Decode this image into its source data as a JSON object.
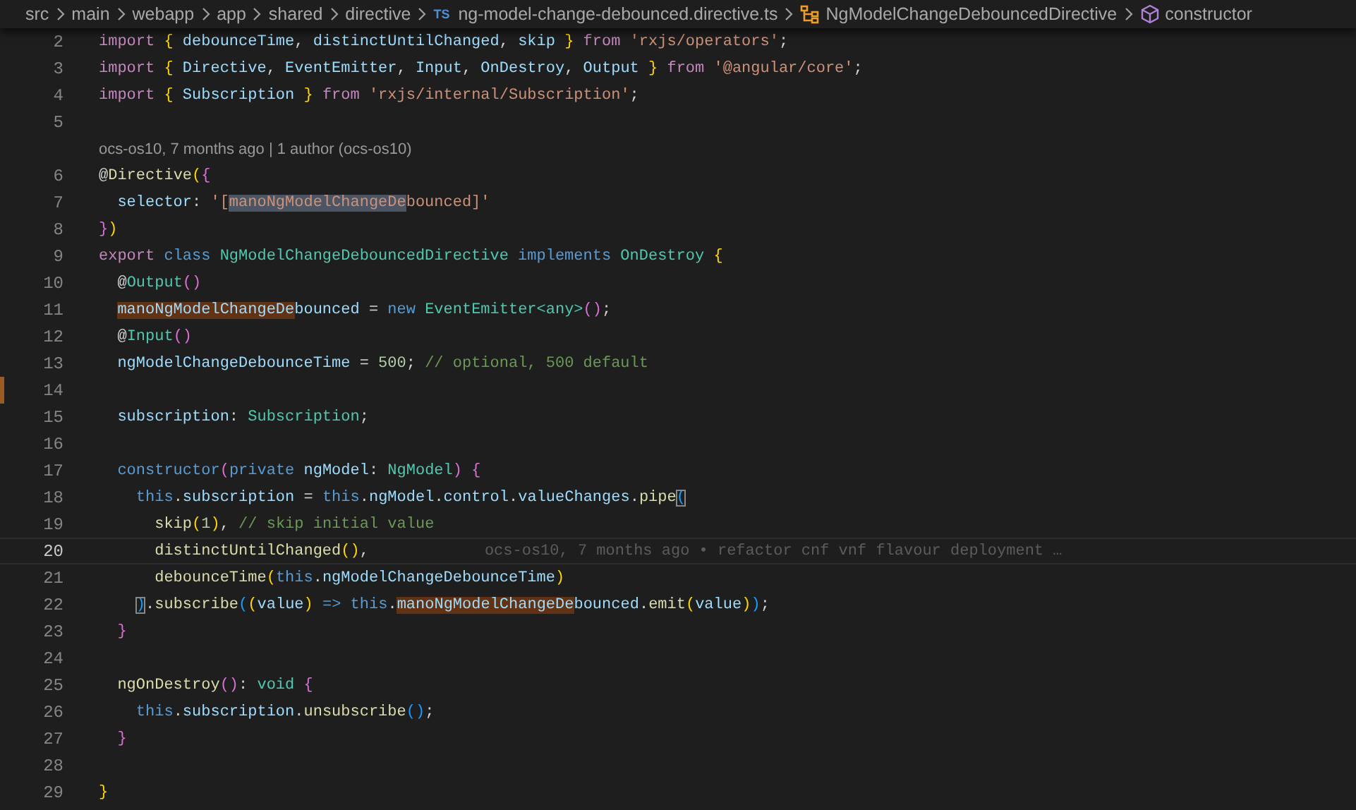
{
  "breadcrumb": [
    {
      "label": "src",
      "kind": "folder"
    },
    {
      "label": "main",
      "kind": "folder"
    },
    {
      "label": "webapp",
      "kind": "folder"
    },
    {
      "label": "app",
      "kind": "folder"
    },
    {
      "label": "shared",
      "kind": "folder"
    },
    {
      "label": "directive",
      "kind": "folder"
    },
    {
      "label": "ng-model-change-debounced.directive.ts",
      "kind": "file",
      "icon_text": "TS"
    },
    {
      "label": "NgModelChangeDebouncedDirective",
      "kind": "class"
    },
    {
      "label": "constructor",
      "kind": "method"
    }
  ],
  "editor": {
    "lines": [
      {
        "number": "2",
        "current": false,
        "tokens": [
          {
            "text": "import",
            "kind": "kw"
          },
          {
            "text": " {",
            "kind": "b1"
          },
          {
            "text": " debounceTime",
            "kind": "var"
          },
          {
            "text": ", ",
            "kind": "p"
          },
          {
            "text": "distinctUntilChanged",
            "kind": "var"
          },
          {
            "text": ", ",
            "kind": "p"
          },
          {
            "text": "skip ",
            "kind": "var"
          },
          {
            "text": "}",
            "kind": "b1"
          },
          {
            "text": " from",
            "kind": "kw"
          },
          {
            "text": " 'rxjs/operators'",
            "kind": "str"
          },
          {
            "text": ";",
            "kind": "p"
          }
        ]
      },
      {
        "number": "3",
        "current": false,
        "tokens": [
          {
            "text": "import",
            "kind": "kw"
          },
          {
            "text": " {",
            "kind": "b1"
          },
          {
            "text": " Directive",
            "kind": "var"
          },
          {
            "text": ", ",
            "kind": "p"
          },
          {
            "text": "EventEmitter",
            "kind": "var"
          },
          {
            "text": ", ",
            "kind": "p"
          },
          {
            "text": "Input",
            "kind": "var"
          },
          {
            "text": ", ",
            "kind": "p"
          },
          {
            "text": "OnDestroy",
            "kind": "var"
          },
          {
            "text": ", ",
            "kind": "p"
          },
          {
            "text": "Output ",
            "kind": "var"
          },
          {
            "text": "}",
            "kind": "b1"
          },
          {
            "text": " from",
            "kind": "kw"
          },
          {
            "text": " '@angular/core'",
            "kind": "str"
          },
          {
            "text": ";",
            "kind": "p"
          }
        ]
      },
      {
        "number": "4",
        "current": false,
        "tokens": [
          {
            "text": "import",
            "kind": "kw"
          },
          {
            "text": " {",
            "kind": "b1"
          },
          {
            "text": " Subscription ",
            "kind": "var"
          },
          {
            "text": "}",
            "kind": "b1"
          },
          {
            "text": " from",
            "kind": "kw"
          },
          {
            "text": " 'rxjs/internal/Subscription'",
            "kind": "str"
          },
          {
            "text": ";",
            "kind": "p"
          }
        ]
      },
      {
        "number": "5",
        "current": false,
        "codelens": "ocs-os10, 7 months ago | 1 author (ocs-os10)"
      },
      {
        "number": "6",
        "current": false,
        "tokens": [
          {
            "text": "@",
            "kind": "p"
          },
          {
            "text": "Directive",
            "kind": "fn"
          },
          {
            "text": "(",
            "kind": "b1"
          },
          {
            "text": "{",
            "kind": "b2"
          }
        ]
      },
      {
        "number": "7",
        "current": false,
        "tokens": [
          {
            "text": "  selector",
            "kind": "var"
          },
          {
            "text": ": ",
            "kind": "p"
          },
          {
            "text": "'[",
            "kind": "str"
          },
          {
            "text": "manoNgModelChangeDe",
            "kind": "str",
            "selection": true
          },
          {
            "text": "bounced]'",
            "kind": "str"
          }
        ]
      },
      {
        "number": "8",
        "current": false,
        "tokens": [
          {
            "text": "}",
            "kind": "b2"
          },
          {
            "text": ")",
            "kind": "b1"
          }
        ]
      },
      {
        "number": "9",
        "current": false,
        "tokens": [
          {
            "text": "export",
            "kind": "kw"
          },
          {
            "text": " class",
            "kind": "storage"
          },
          {
            "text": " NgModelChangeDebouncedDirective",
            "kind": "type"
          },
          {
            "text": " implements",
            "kind": "storage"
          },
          {
            "text": " OnDestroy",
            "kind": "type"
          },
          {
            "text": " {",
            "kind": "b1"
          }
        ]
      },
      {
        "number": "10",
        "current": false,
        "tokens": [
          {
            "text": "  @",
            "kind": "p"
          },
          {
            "text": "Output",
            "kind": "type"
          },
          {
            "text": "()",
            "kind": "b2"
          }
        ]
      },
      {
        "number": "11",
        "current": false,
        "tokens": [
          {
            "text": "  manoNgModelChangeDe",
            "kind": "var",
            "word_highlight": true
          },
          {
            "text": "bounced",
            "kind": "var"
          },
          {
            "text": " = ",
            "kind": "p"
          },
          {
            "text": "new",
            "kind": "storage"
          },
          {
            "text": " EventEmitter<any>",
            "kind": "type"
          },
          {
            "text": "()",
            "kind": "b2"
          },
          {
            "text": ";",
            "kind": "p"
          }
        ]
      },
      {
        "number": "12",
        "current": false,
        "tokens": [
          {
            "text": "  @",
            "kind": "p"
          },
          {
            "text": "Input",
            "kind": "type"
          },
          {
            "text": "()",
            "kind": "b2"
          }
        ]
      },
      {
        "number": "13",
        "current": false,
        "tokens": [
          {
            "text": "  ngModelChangeDebounceTime",
            "kind": "var"
          },
          {
            "text": " = ",
            "kind": "p"
          },
          {
            "text": "500",
            "kind": "num"
          },
          {
            "text": "; ",
            "kind": "p"
          },
          {
            "text": "// optional, 500 default",
            "kind": "comment"
          }
        ]
      },
      {
        "number": "14",
        "current": false,
        "modified": true
      },
      {
        "number": "15",
        "current": false,
        "tokens": [
          {
            "text": "  subscription",
            "kind": "var"
          },
          {
            "text": ": ",
            "kind": "p"
          },
          {
            "text": "Subscription",
            "kind": "type"
          },
          {
            "text": ";",
            "kind": "p"
          }
        ]
      },
      {
        "number": "16",
        "current": false
      },
      {
        "number": "17",
        "current": false,
        "tokens": [
          {
            "text": "  constructor",
            "kind": "storage"
          },
          {
            "text": "(",
            "kind": "b2"
          },
          {
            "text": "private",
            "kind": "storage"
          },
          {
            "text": " ngModel",
            "kind": "var"
          },
          {
            "text": ": ",
            "kind": "p"
          },
          {
            "text": "NgModel",
            "kind": "type"
          },
          {
            "text": ")",
            "kind": "b2"
          },
          {
            "text": " {",
            "kind": "b2"
          }
        ]
      },
      {
        "number": "18",
        "current": false,
        "tokens": [
          {
            "text": "    this",
            "kind": "storage"
          },
          {
            "text": ".",
            "kind": "p"
          },
          {
            "text": "subscription",
            "kind": "var"
          },
          {
            "text": " = ",
            "kind": "p"
          },
          {
            "text": "this",
            "kind": "storage"
          },
          {
            "text": ".",
            "kind": "p"
          },
          {
            "text": "ngModel",
            "kind": "var"
          },
          {
            "text": ".",
            "kind": "p"
          },
          {
            "text": "control",
            "kind": "var"
          },
          {
            "text": ".",
            "kind": "p"
          },
          {
            "text": "valueChanges",
            "kind": "var"
          },
          {
            "text": ".",
            "kind": "p"
          },
          {
            "text": "pipe",
            "kind": "fn"
          },
          {
            "text": "(",
            "kind": "b3",
            "bracket_match": true
          }
        ]
      },
      {
        "number": "19",
        "current": false,
        "tokens": [
          {
            "text": "      skip",
            "kind": "fn"
          },
          {
            "text": "(",
            "kind": "b1"
          },
          {
            "text": "1",
            "kind": "num"
          },
          {
            "text": ")",
            "kind": "b1"
          },
          {
            "text": ", ",
            "kind": "p"
          },
          {
            "text": "// skip initial value",
            "kind": "comment"
          }
        ]
      },
      {
        "number": "20",
        "current": true,
        "tokens": [
          {
            "text": "      distinctUntilChanged",
            "kind": "fn"
          },
          {
            "text": "()",
            "kind": "b1"
          },
          {
            "text": ",",
            "kind": "p"
          }
        ],
        "blame": "ocs-os10, 7 months ago • refactor cnf vnf flavour deployment …"
      },
      {
        "number": "21",
        "current": false,
        "tokens": [
          {
            "text": "      debounceTime",
            "kind": "fn"
          },
          {
            "text": "(",
            "kind": "b1"
          },
          {
            "text": "this",
            "kind": "storage"
          },
          {
            "text": ".",
            "kind": "p"
          },
          {
            "text": "ngModelChangeDebounceTime",
            "kind": "var"
          },
          {
            "text": ")",
            "kind": "b1"
          }
        ]
      },
      {
        "number": "22",
        "current": false,
        "tokens": [
          {
            "text": "    )",
            "kind": "b3",
            "bracket_match": true
          },
          {
            "text": ".",
            "kind": "p"
          },
          {
            "text": "subscribe",
            "kind": "fn"
          },
          {
            "text": "(",
            "kind": "b3"
          },
          {
            "text": "(",
            "kind": "b1"
          },
          {
            "text": "value",
            "kind": "var"
          },
          {
            "text": ")",
            "kind": "b1"
          },
          {
            "text": " => ",
            "kind": "storage"
          },
          {
            "text": "this",
            "kind": "storage"
          },
          {
            "text": ".",
            "kind": "p"
          },
          {
            "text": "manoNgModelChangeDe",
            "kind": "var",
            "word_highlight": true
          },
          {
            "text": "bounced",
            "kind": "var"
          },
          {
            "text": ".",
            "kind": "p"
          },
          {
            "text": "emit",
            "kind": "fn"
          },
          {
            "text": "(",
            "kind": "b1"
          },
          {
            "text": "value",
            "kind": "var"
          },
          {
            "text": ")",
            "kind": "b1"
          },
          {
            "text": ")",
            "kind": "b3"
          },
          {
            "text": ";",
            "kind": "p"
          }
        ]
      },
      {
        "number": "23",
        "current": false,
        "tokens": [
          {
            "text": "  }",
            "kind": "b2"
          }
        ]
      },
      {
        "number": "24",
        "current": false
      },
      {
        "number": "25",
        "current": false,
        "tokens": [
          {
            "text": "  ngOnDestroy",
            "kind": "fn"
          },
          {
            "text": "()",
            "kind": "b2"
          },
          {
            "text": ": ",
            "kind": "p"
          },
          {
            "text": "void",
            "kind": "type"
          },
          {
            "text": " {",
            "kind": "b2"
          }
        ]
      },
      {
        "number": "26",
        "current": false,
        "tokens": [
          {
            "text": "    this",
            "kind": "storage"
          },
          {
            "text": ".",
            "kind": "p"
          },
          {
            "text": "subscription",
            "kind": "var"
          },
          {
            "text": ".",
            "kind": "p"
          },
          {
            "text": "unsubscribe",
            "kind": "fn"
          },
          {
            "text": "()",
            "kind": "b3"
          },
          {
            "text": ";",
            "kind": "p"
          }
        ]
      },
      {
        "number": "27",
        "current": false,
        "tokens": [
          {
            "text": "  }",
            "kind": "b2"
          }
        ]
      },
      {
        "number": "28",
        "current": false
      },
      {
        "number": "29",
        "current": false,
        "tokens": [
          {
            "text": "}",
            "kind": "b1"
          }
        ]
      }
    ]
  }
}
